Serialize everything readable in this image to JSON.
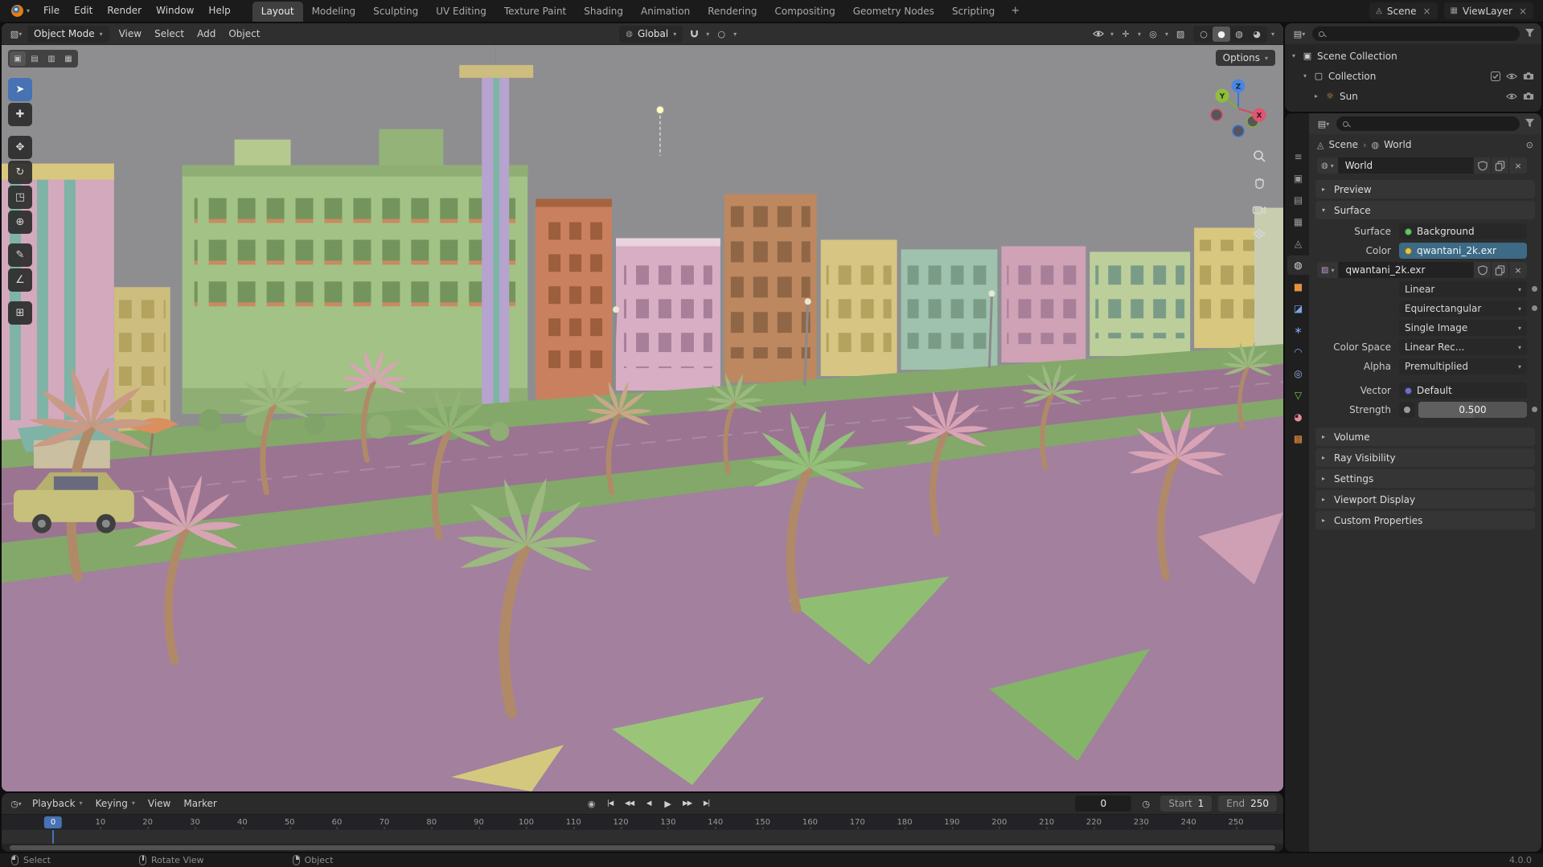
{
  "topbar": {
    "app_menus": [
      "File",
      "Edit",
      "Render",
      "Window",
      "Help"
    ],
    "workspaces": [
      "Layout",
      "Modeling",
      "Sculpting",
      "UV Editing",
      "Texture Paint",
      "Shading",
      "Animation",
      "Rendering",
      "Compositing",
      "Geometry Nodes",
      "Scripting"
    ],
    "active_workspace": "Layout",
    "add_workspace_label": "+",
    "scene_name": "Scene",
    "viewlayer_name": "ViewLayer"
  },
  "viewport": {
    "header": {
      "mode": "Object Mode",
      "menus": [
        "View",
        "Select",
        "Add",
        "Object"
      ],
      "orientation": "Global",
      "shading_modes": [
        {
          "name": "wireframe",
          "glyph": "○"
        },
        {
          "name": "solid",
          "glyph": "●",
          "active": true
        },
        {
          "name": "material-preview",
          "glyph": "◍"
        },
        {
          "name": "rendered",
          "glyph": "◕"
        }
      ]
    },
    "options_label": "Options",
    "select_modes": [
      {
        "name": "select-new",
        "glyph": "▣"
      },
      {
        "name": "select-extend",
        "glyph": "▤"
      },
      {
        "name": "select-subtract",
        "glyph": "▥"
      },
      {
        "name": "select-intersect",
        "glyph": "▦"
      }
    ],
    "tools": [
      {
        "name": "tweak-select",
        "glyph": "➤",
        "active": true
      },
      {
        "name": "cursor",
        "glyph": "✚"
      },
      {
        "name": "move",
        "glyph": "✥",
        "group_break": true
      },
      {
        "name": "rotate",
        "glyph": "↻"
      },
      {
        "name": "scale",
        "glyph": "◳"
      },
      {
        "name": "transform",
        "glyph": "⊕"
      },
      {
        "name": "annotate",
        "glyph": "✎",
        "group_break": true
      },
      {
        "name": "measure",
        "glyph": "∠"
      },
      {
        "name": "add-cube",
        "glyph": "⊞",
        "group_break": true
      }
    ],
    "gizmo": {
      "x": "X",
      "y": "Y",
      "z": "Z"
    }
  },
  "outliner": {
    "search_placeholder": "",
    "rows": [
      {
        "label": "Scene Collection",
        "icon": "scene-collection",
        "glyph": "▣",
        "color": "#d0d0d0",
        "level": 0,
        "expand": "▾",
        "trailing": []
      },
      {
        "label": "Collection",
        "icon": "collection",
        "glyph": "▢",
        "color": "#d0d0d0",
        "level": 1,
        "expand": "▾",
        "trailing": [
          "checkbox",
          "eye",
          "camera"
        ]
      },
      {
        "label": "Sun",
        "icon": "sun-light",
        "glyph": "☼",
        "color": "#e0a35a",
        "level": 2,
        "expand": "▸",
        "trailing": [
          "eye",
          "camera"
        ]
      }
    ]
  },
  "properties": {
    "search_placeholder": "",
    "tabs": [
      {
        "name": "tool",
        "glyph": "≡",
        "color": "#9a9a9a"
      },
      {
        "name": "render",
        "glyph": "▣",
        "color": "#9a9a9a"
      },
      {
        "name": "output",
        "glyph": "▤",
        "color": "#9a9a9a"
      },
      {
        "name": "view-layer",
        "glyph": "▦",
        "color": "#9a9a9a"
      },
      {
        "name": "scene",
        "glyph": "◬",
        "color": "#9a9a9a"
      },
      {
        "name": "world",
        "glyph": "◍",
        "color": "#d8d8d8",
        "active": true
      },
      {
        "name": "object",
        "glyph": "■",
        "color": "#e8913f"
      },
      {
        "name": "modifiers",
        "glyph": "◪",
        "color": "#7ca6e8"
      },
      {
        "name": "particles",
        "glyph": "∗",
        "color": "#7ca6e8"
      },
      {
        "name": "physics",
        "glyph": "◠",
        "color": "#7ca6e8"
      },
      {
        "name": "constraints",
        "glyph": "◎",
        "color": "#9ab8e8"
      },
      {
        "name": "object-data",
        "glyph": "▽",
        "color": "#7ec850"
      },
      {
        "name": "material",
        "glyph": "◕",
        "color": "#e88896"
      },
      {
        "name": "texture",
        "glyph": "▩",
        "color": "#e8913f"
      }
    ],
    "breadcrumb": {
      "scene": "Scene",
      "world": "World"
    },
    "datablock_name": "World",
    "panels": {
      "preview": "Preview",
      "surface": "Surface",
      "volume": "Volume",
      "ray_visibility": "Ray Visibility",
      "settings": "Settings",
      "viewport_display": "Viewport Display",
      "custom_properties": "Custom Properties"
    },
    "surface": {
      "surface_label": "Surface",
      "surface_value": "Background",
      "color_label": "Color",
      "color_value": "qwantani_2k.exr",
      "image_name": "qwantani_2k.exr",
      "interpolation": "Linear",
      "projection": "Equirectangular",
      "source": "Single Image",
      "color_space_label": "Color Space",
      "color_space_value": "Linear Rec...",
      "alpha_label": "Alpha",
      "alpha_value": "Premultiplied",
      "vector_label": "Vector",
      "vector_value": "Default",
      "strength_label": "Strength",
      "strength_value": "0.500"
    }
  },
  "timeline": {
    "menus": [
      {
        "label": "Playback",
        "caret": true
      },
      {
        "label": "Keying",
        "caret": true
      },
      {
        "label": "View",
        "caret": false
      },
      {
        "label": "Marker",
        "caret": false
      }
    ],
    "transport": [
      {
        "name": "jump-to-start",
        "glyph": "|◀"
      },
      {
        "name": "prev-keyframe",
        "glyph": "◀◀"
      },
      {
        "name": "play-reverse",
        "glyph": "◀"
      },
      {
        "name": "play",
        "glyph": "▶"
      },
      {
        "name": "next-keyframe",
        "glyph": "▶▶"
      },
      {
        "name": "jump-to-end",
        "glyph": "▶|"
      }
    ],
    "current_frame": "0",
    "playhead_label": "0",
    "start_label": "Start",
    "start_value": "1",
    "end_label": "End",
    "end_value": "250",
    "ticks": [
      10,
      20,
      30,
      40,
      50,
      60,
      70,
      80,
      90,
      100,
      110,
      120,
      130,
      140,
      150,
      160,
      170,
      180,
      190,
      200,
      210,
      220,
      230,
      240,
      250
    ]
  },
  "statusbar": {
    "hints": [
      {
        "button": "left",
        "label": "Select"
      },
      {
        "button": "middle",
        "label": "Rotate View"
      },
      {
        "button": "right",
        "label": "Object"
      }
    ],
    "version": "4.0.0"
  }
}
